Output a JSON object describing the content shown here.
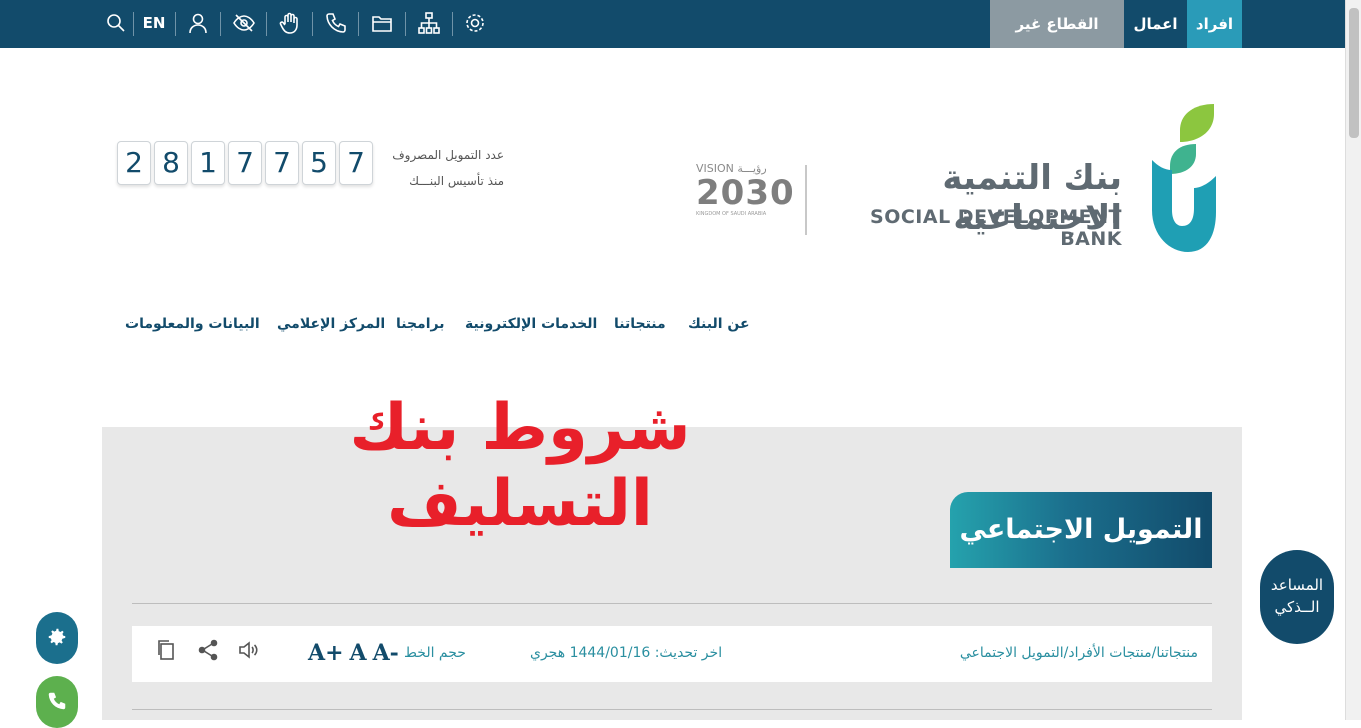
{
  "topbar": {
    "segments": {
      "individuals": "افراد",
      "business": "اعمال",
      "nonprofit": "القطاع غير الربحي"
    },
    "lang": "EN",
    "icons": [
      "search-icon",
      "user-icon",
      "eye-slash-icon",
      "hand-icon",
      "phone-icon",
      "folder-icon",
      "sitemap-icon",
      "settings-icon"
    ],
    "colors": {
      "bar": "#124b6b",
      "active": "#2a9bb8",
      "muted": "#8c9aa2"
    }
  },
  "brand": {
    "name_ar": "بنك التنمية الاجتماعية",
    "name_en": "SOCIAL DEVELOPMENT BANK",
    "vision_top": "VISION رؤيـــة",
    "vision_num": "2030",
    "vision_sub": "KINGDOM OF SAUDI ARABIA"
  },
  "counter": {
    "label_line1": "عدد التمويل المصروف",
    "label_line2": "منذ تأسيس البنـــك",
    "digits": [
      "2",
      "8",
      "1",
      "7",
      "7",
      "5",
      "7"
    ]
  },
  "nav": {
    "about": "عن البنك",
    "products": "منتجاتنا",
    "eservices": "الخدمات الإلكترونية",
    "programs": "برامجنا",
    "media": "المركز الإعلامي",
    "data": "البيانات والمعلومات"
  },
  "main": {
    "headline": "شروط بنك التسليف",
    "section_title": "التمويل الاجتماعي",
    "breadcrumb": "منتجاتنا/منتجات الأفراد/التمويل الاجتماعي",
    "updated": "اخر تحديث: 1444/01/16 هجري",
    "font_size_label": "حجم الخط",
    "font_plus": "A+",
    "font_normal": "A",
    "font_minus": "A-"
  },
  "assistant": {
    "line1": "المساعد",
    "line2": "الــذكي"
  }
}
